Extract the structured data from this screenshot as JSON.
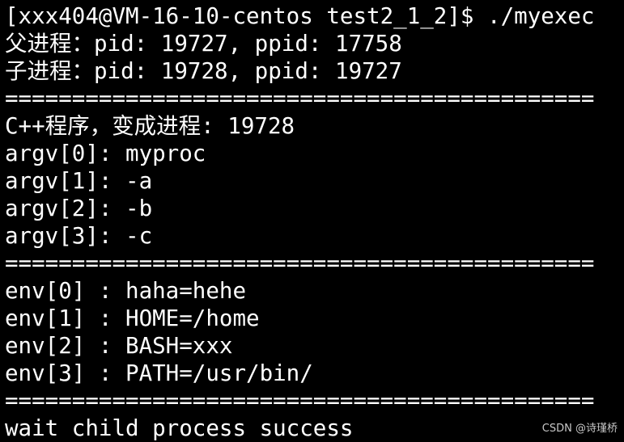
{
  "terminal": {
    "lines": [
      "[xxx404@VM-16-10-centos test2_1_2]$ ./myexec",
      "父进程：pid: 19727, ppid: 17758",
      "子进程：pid: 19728, ppid: 19727",
      "============================================",
      "C++程序，变成进程: 19728",
      "argv[0]: myproc",
      "argv[1]: -a",
      "argv[2]: -b",
      "argv[3]: -c",
      "============================================",
      "env[0] : haha=hehe",
      "env[1] : HOME=/home",
      "env[2] : BASH=xxx",
      "env[3] : PATH=/usr/bin/",
      "============================================",
      "wait child process success"
    ]
  },
  "watermark": "CSDN @诗瑾桥",
  "colors": {
    "background": "#000000",
    "foreground": "#ffffff",
    "watermark": "#c8c8c8"
  }
}
